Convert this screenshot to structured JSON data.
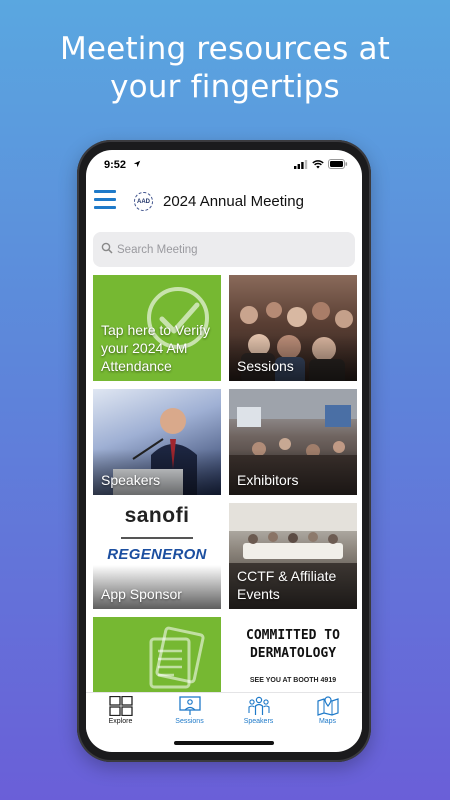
{
  "headline": {
    "line1": "Meeting resources at",
    "line2": "your fingertips"
  },
  "status_bar": {
    "time": "9:52",
    "icons": [
      "location-arrow-icon",
      "signal-icon",
      "wifi-icon",
      "battery-icon"
    ]
  },
  "header": {
    "menu_icon": "hamburger-menu-icon",
    "logo_text": "AAD",
    "title": "2024 Annual Meeting"
  },
  "search": {
    "placeholder": "Search Meeting"
  },
  "tiles": [
    {
      "label": "Tap here to Verify your 2024 AM Attendance",
      "icon": "checkmark-circle-icon"
    },
    {
      "label": "Sessions"
    },
    {
      "label": "Speakers"
    },
    {
      "label": "Exhibitors"
    },
    {
      "label": "App Sponsor",
      "sponsor_1": "sanofi",
      "sponsor_2": "REGENERON"
    },
    {
      "label": "CCTF & Affiliate Events"
    },
    {
      "label": "",
      "icon": "documents-icon"
    },
    {
      "label": "",
      "heading": "COMMITTED TO DERMATOLOGY",
      "sub": "SEE YOU AT BOOTH 4919"
    }
  ],
  "tabbar": {
    "items": [
      {
        "label": "Explore",
        "icon": "grid-icon",
        "active": true
      },
      {
        "label": "Sessions",
        "icon": "presentation-icon",
        "active": false
      },
      {
        "label": "Speakers",
        "icon": "people-icon",
        "active": false
      },
      {
        "label": "Maps",
        "icon": "map-pin-icon",
        "active": false
      }
    ]
  },
  "colors": {
    "accent": "#1f7ac9",
    "tile_green": "#76b832"
  }
}
